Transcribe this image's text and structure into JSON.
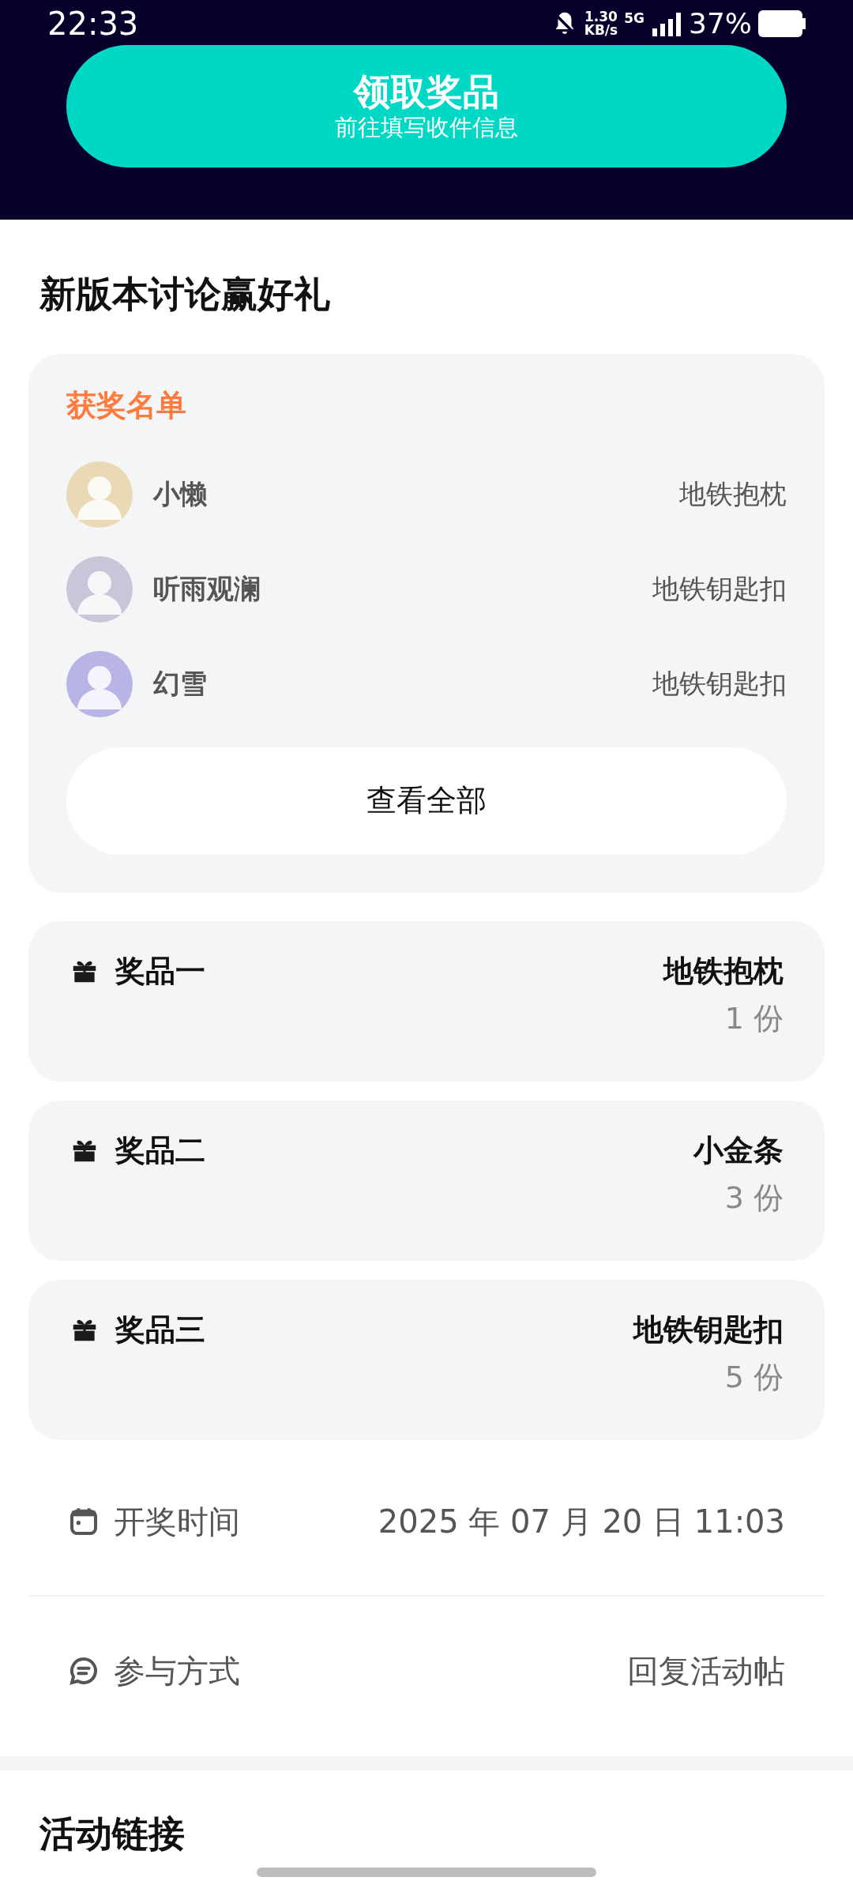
{
  "status_bar": {
    "time": "22:33",
    "speed_value": "1.30",
    "speed_unit": "KB/s",
    "network": "5G",
    "battery": "37%"
  },
  "claim_button": {
    "title": "领取奖品",
    "subtitle": "前往填写收件信息"
  },
  "title": "新版本讨论赢好礼",
  "winners": {
    "heading": "获奖名单",
    "items": [
      {
        "name": "小懒",
        "prize": "地铁抱枕"
      },
      {
        "name": "听雨观澜",
        "prize": "地铁钥匙扣"
      },
      {
        "name": "幻雪",
        "prize": "地铁钥匙扣"
      }
    ],
    "view_all": "查看全部"
  },
  "prizes": [
    {
      "label": "奖品一",
      "name": "地铁抱枕",
      "count": "1 份"
    },
    {
      "label": "奖品二",
      "name": "小金条",
      "count": "3 份"
    },
    {
      "label": "奖品三",
      "name": "地铁钥匙扣",
      "count": "5 份"
    }
  ],
  "info": [
    {
      "kind": "calendar",
      "label": "开奖时间",
      "value": "2025 年 07 月 20 日 11:03"
    },
    {
      "kind": "chat",
      "label": "参与方式",
      "value": "回复活动帖"
    }
  ],
  "links_title": "活动链接"
}
